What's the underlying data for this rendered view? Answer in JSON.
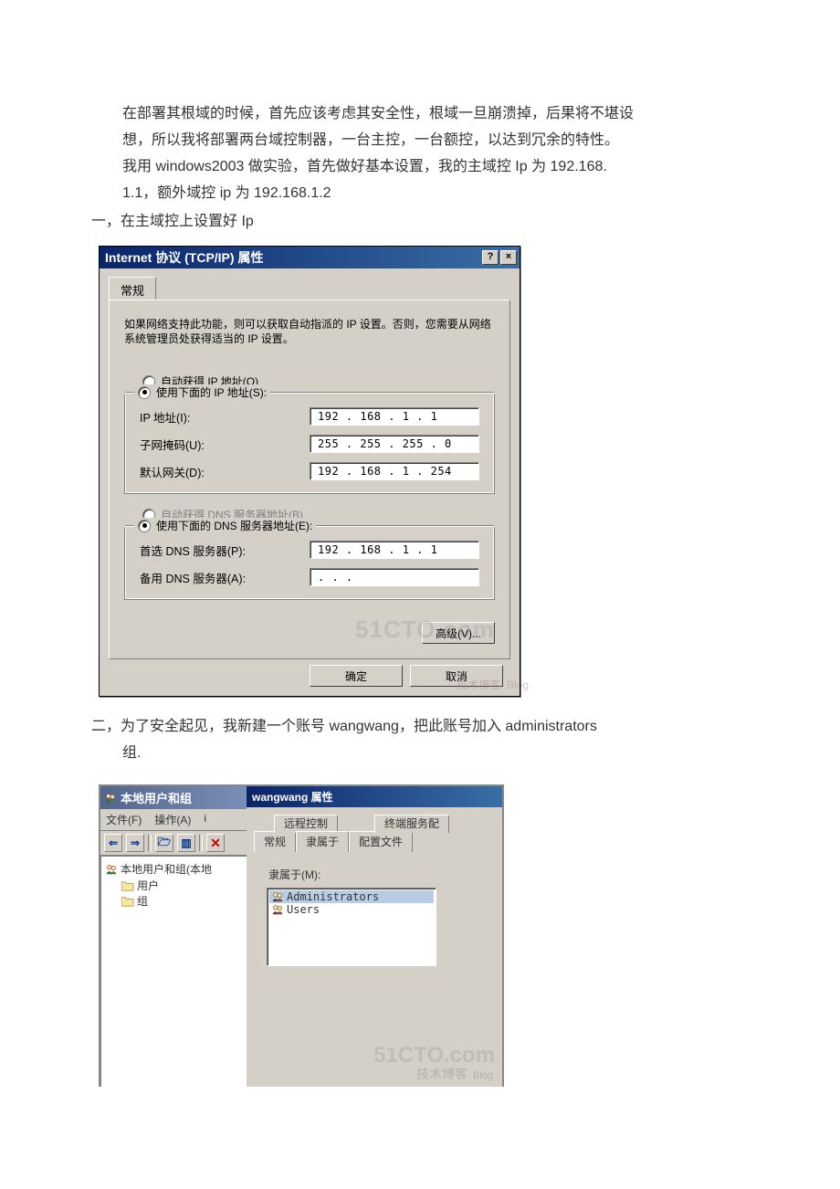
{
  "intro": {
    "line1": "在部署其根域的时候，首先应该考虑其安全性，根域一旦崩溃掉，后果将不堪设",
    "line2": "想，所以我将部署两台域控制器，一台主控，一台额控，以达到冗余的特性。",
    "line3a": "我用 ",
    "line3b": "windows2003",
    "line3c": " 做实验，首先做好基本设置，我的主域控 Ip 为 192.168.",
    "line4": "1.1，额外域控 ip 为 192.168.1.2"
  },
  "sec1": "一，在主域控上设置好 Ip",
  "tcpip": {
    "title": "Internet 协议 (TCP/IP) 属性",
    "help": "?",
    "close": "×",
    "tab_general": "常规",
    "desc": "如果网络支持此功能，则可以获取自动指派的 IP 设置。否则，您需要从网络系统管理员处获得适当的 IP 设置。",
    "radio_auto_ip": "自动获得 IP 地址(O)",
    "radio_use_ip": "使用下面的 IP 地址(S):",
    "label_ip": "IP 地址(I):",
    "value_ip": "192 . 168 .  1  .  1",
    "label_mask": "子网掩码(U):",
    "value_mask": "255 . 255 . 255 .  0",
    "label_gateway": "默认网关(D):",
    "value_gateway": "192 . 168 .  1  . 254",
    "radio_auto_dns": "自动获得 DNS 服务器地址(B)",
    "radio_use_dns": "使用下面的 DNS 服务器地址(E):",
    "label_dns1": "首选 DNS 服务器(P):",
    "value_dns1": "192 . 168 .  1  .  1",
    "label_dns2": "备用 DNS 服务器(A):",
    "value_dns2": "   .     .     .   ",
    "btn_advanced": "高级(V)...",
    "btn_ok": "确定",
    "btn_cancel": "取消"
  },
  "sec2a": "二，为了安全起见，我新建一个账号 wangwang，把此账号加入 administrators",
  "sec2b": "组.",
  "mmc": {
    "title": "本地用户和组",
    "menu_file": "文件(F)",
    "menu_action": "操作(A)",
    "toolbar": {
      "back": "⇐",
      "fwd": "⇒",
      "up": "🗁",
      "props": "▥",
      "del": "✕"
    },
    "root": "本地用户和组(本地",
    "users": "用户",
    "groups": "组"
  },
  "prop": {
    "title": "wangwang 属性",
    "tab_remote": "远程控制",
    "tab_ts": "终端服务配",
    "tab_general": "常规",
    "tab_memberof": "隶属于",
    "tab_profile": "配置文件",
    "memberof_label": "隶属于(M):",
    "item_admin": "Administrators",
    "item_users": "Users"
  },
  "watermark": {
    "brand": "51CTO.com",
    "sub": "技术博客",
    "blog": "Blog"
  }
}
